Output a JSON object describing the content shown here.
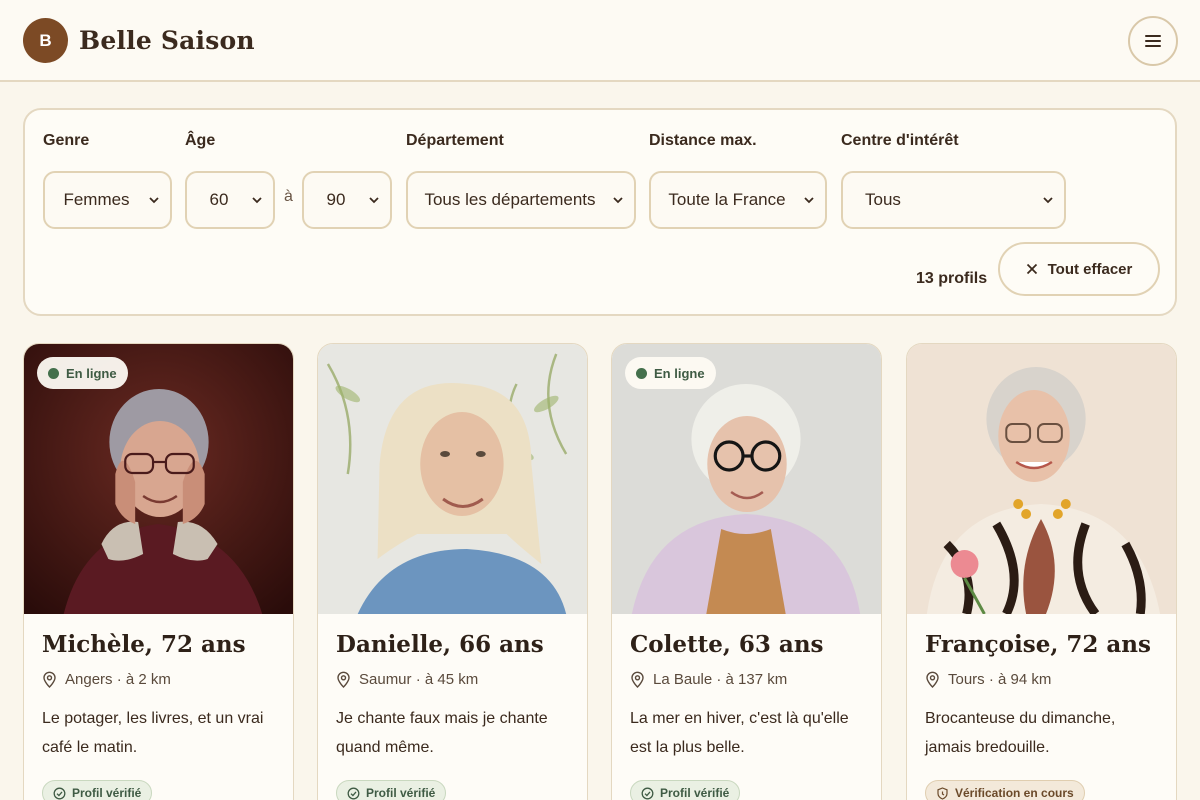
{
  "header": {
    "logo_letter": "B",
    "brand": "Belle Saison",
    "menu_icon": "hamburger-menu-icon"
  },
  "filters": {
    "genre": {
      "label": "Genre",
      "value": "Femmes"
    },
    "age": {
      "label": "Âge",
      "min": "60",
      "separator": "à",
      "max": "90"
    },
    "departement": {
      "label": "Département",
      "value": "Tous les départements"
    },
    "distance": {
      "label": "Distance max.",
      "value": "Toute la France"
    },
    "interet": {
      "label": "Centre d'intérêt",
      "value": "Tous"
    },
    "count": "13 profils",
    "clear_label": "Tout effacer"
  },
  "profiles": [
    {
      "name": "Michèle, 72 ans",
      "location": "Angers · à 2 km",
      "bio": "Le potager, les livres, et un vrai café le matin.",
      "online": "En ligne",
      "verification": "Profil vérifié",
      "status": "verified"
    },
    {
      "name": "Danielle, 66 ans",
      "location": "Saumur · à 45 km",
      "bio": "Je chante faux mais je chante quand même.",
      "online": "",
      "verification": "Profil vérifié",
      "status": "verified"
    },
    {
      "name": "Colette, 63 ans",
      "location": "La Baule · à 137 km",
      "bio": "La mer en hiver, c'est là qu'elle est la plus belle.",
      "online": "En ligne",
      "verification": "Profil vérifié",
      "status": "verified"
    },
    {
      "name": "Françoise, 72 ans",
      "location": "Tours · à 94 km",
      "bio": "Brocanteuse du dimanche, jamais bredouille.",
      "online": "",
      "verification": "Vérification en cours",
      "status": "pending"
    }
  ],
  "colors": {
    "brand": "#7c4a25",
    "background": "#faf6ec",
    "online": "#44704c",
    "border": "#e4d8c1"
  }
}
